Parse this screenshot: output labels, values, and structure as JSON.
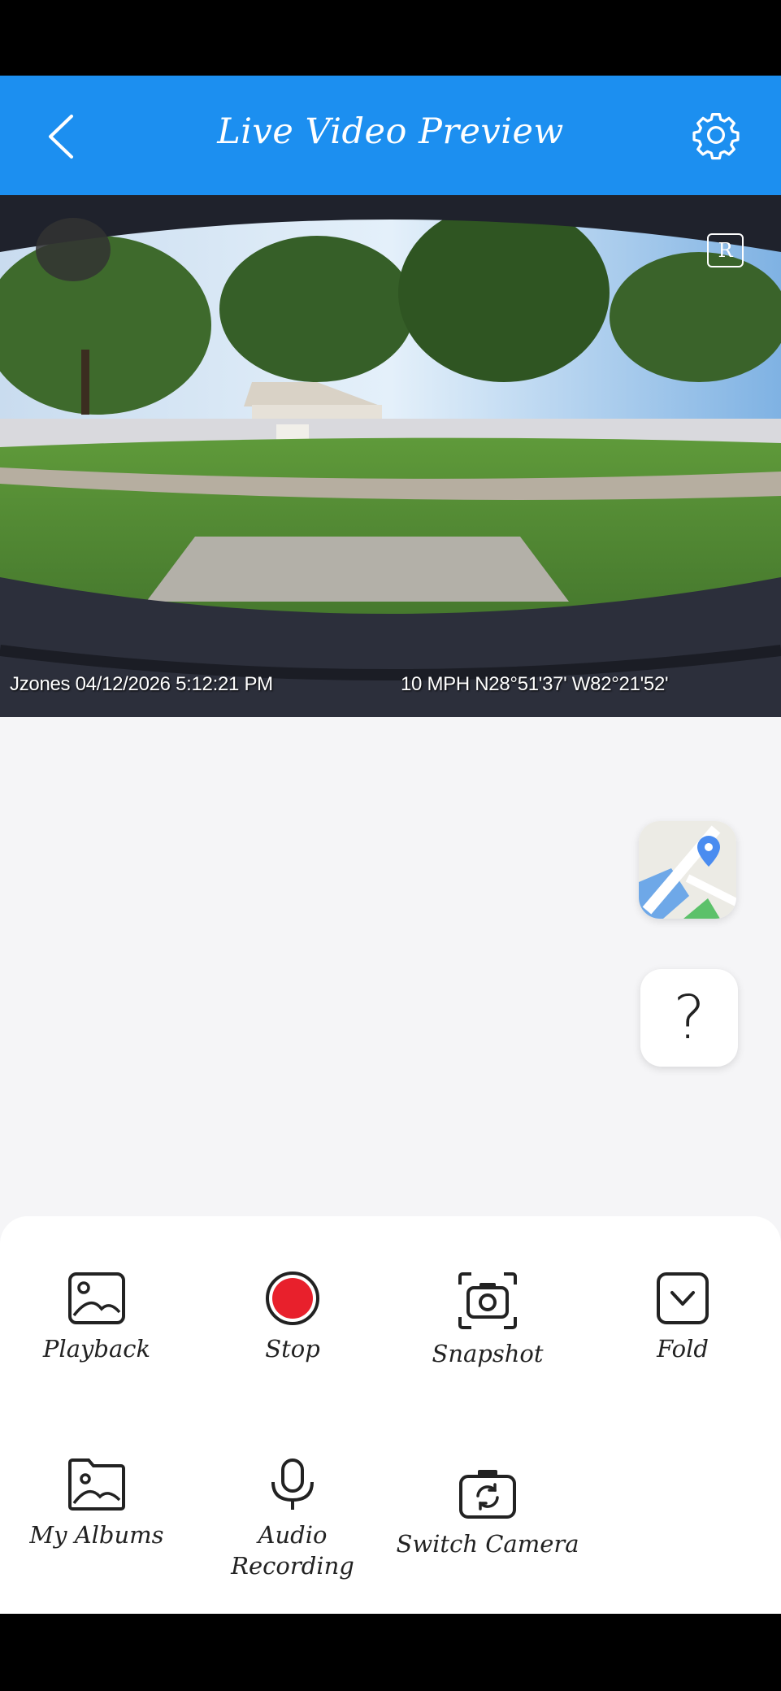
{
  "header": {
    "title": "Live Video Preview",
    "back_icon": "chevron-left-icon",
    "settings_icon": "gear-icon"
  },
  "video": {
    "badge": "R",
    "osd_left": "Jzones 04/12/2026 5:12:21 PM",
    "osd_right": "10 MPH N28°51'37' W82°21'52'"
  },
  "floating": {
    "map_icon": "map-icon",
    "help_text": "?"
  },
  "tools": {
    "playback": "Playback",
    "stop": "Stop",
    "snapshot": "Snapshot",
    "fold": "Fold",
    "my_albums": "My Albums",
    "audio_line1": "Audio",
    "audio_line2": "Recording",
    "switch_camera": "Switch Camera"
  },
  "colors": {
    "header": "#1c8ff0",
    "record": "#e8202c"
  }
}
